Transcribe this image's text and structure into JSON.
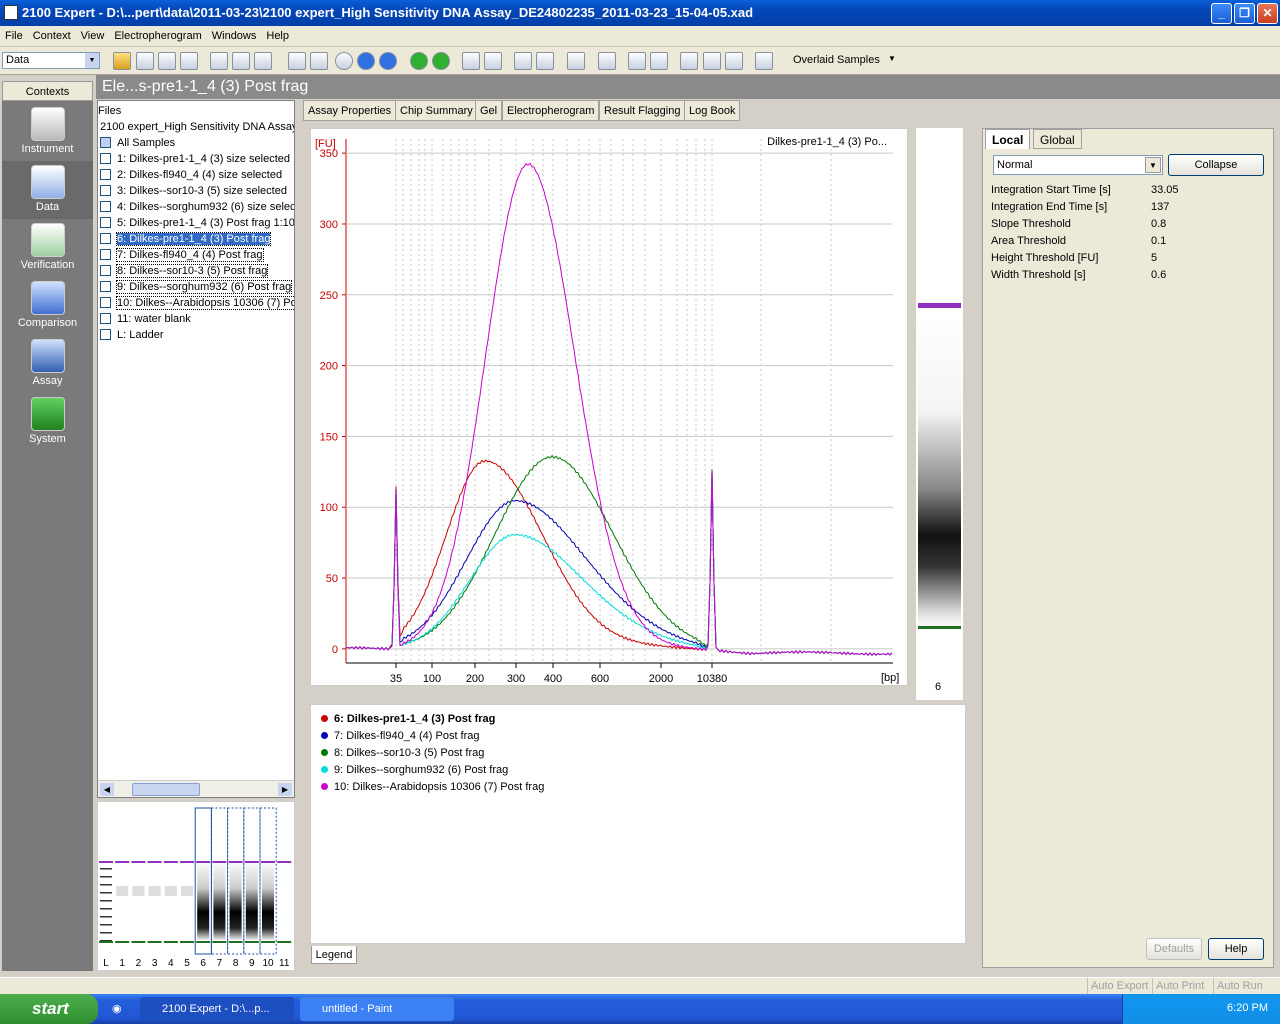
{
  "window": {
    "title": "2100 Expert - D:\\...pert\\data\\2011-03-23\\2100 expert_High Sensitivity DNA Assay_DE24802235_2011-03-23_15-04-05.xad"
  },
  "menu": [
    "File",
    "Context",
    "View",
    "Electropherogram",
    "Windows",
    "Help"
  ],
  "toolbar": {
    "context_value": "Data",
    "overlaid_label": "Overlaid Samples"
  },
  "contexts": {
    "header": "Contexts",
    "items": [
      "Instrument",
      "Data",
      "Verification",
      "Comparison",
      "Assay",
      "System"
    ]
  },
  "section_title": "Ele...s-pre1-1_4 (3) Post frag",
  "files": {
    "header": "Files",
    "assay": "2100 expert_High Sensitivity DNA Assay",
    "all": "All Samples",
    "samples": [
      "1: Dilkes-pre1-1_4 (3) size selected",
      "2: Dilkes-fl940_4 (4) size selected",
      "3: Dilkes--sor10-3 (5) size selected",
      "4: Dilkes--sorghum932 (6) size selected",
      "5: Dilkes-pre1-1_4 (3) Post frag 1:10",
      "6: Dilkes-pre1-1_4 (3) Post frag",
      "7: Dilkes-fl940_4 (4) Post frag",
      "8: Dilkes--sor10-3 (5) Post frag",
      "9: Dilkes--sorghum932 (6) Post frag",
      "10: Dilkes--Arabidopsis 10306 (7) Post frag",
      "11: water blank",
      "L: Ladder"
    ]
  },
  "gel_lanes": [
    "L",
    "1",
    "2",
    "3",
    "4",
    "5",
    "6",
    "7",
    "8",
    "9",
    "10",
    "11"
  ],
  "tabs": [
    "Assay Properties",
    "Chip Summary",
    "Gel",
    "Electropherogram",
    "Result Flagging",
    "Log Book"
  ],
  "chart_data": {
    "type": "line",
    "title": "Dilkes-pre1-1_4 (3) Po...",
    "ylabel": "[FU]",
    "xlabel": "[bp]",
    "ylim": [
      -10,
      360
    ],
    "yticks": [
      0,
      50,
      100,
      150,
      200,
      250,
      300,
      350
    ],
    "xticks": [
      "35",
      "100",
      "200",
      "300",
      "400",
      "600",
      "2000",
      "10380"
    ],
    "series": [
      {
        "name": "6: Dilkes-pre1-1_4 (3) Post frag",
        "color": "#cc0000",
        "peak_fu": 132,
        "peak_bp": 220
      },
      {
        "name": "7: Dilkes-fl940_4 (4) Post frag",
        "color": "#0000b0",
        "peak_fu": 104,
        "peak_bp": 300
      },
      {
        "name": "8: Dilkes--sor10-3 (5) Post frag",
        "color": "#007700",
        "peak_fu": 136,
        "peak_bp": 400
      },
      {
        "name": "9: Dilkes--sorghum932 (6) Post frag",
        "color": "#00dddd",
        "peak_fu": 80,
        "peak_bp": 300
      },
      {
        "name": "10: Dilkes--Arabidopsis 10306 (7) Post frag",
        "color": "#cc00cc",
        "peak_fu": 342,
        "peak_bp": 330
      }
    ]
  },
  "gel_strip_label": "6",
  "legend_tab": "Legend",
  "right": {
    "tabs": [
      "Local",
      "Global"
    ],
    "mode": "Normal",
    "collapse": "Collapse",
    "props": [
      {
        "k": "Integration Start Time [s]",
        "v": "33.05"
      },
      {
        "k": "Integration End Time [s]",
        "v": "137"
      },
      {
        "k": "Slope Threshold",
        "v": "0.8"
      },
      {
        "k": "Area Threshold",
        "v": "0.1"
      },
      {
        "k": "Height Threshold [FU]",
        "v": "5"
      },
      {
        "k": "Width Threshold [s]",
        "v": "0.6"
      }
    ],
    "defaults": "Defaults",
    "help": "Help"
  },
  "status": [
    "Auto Export",
    "Auto Print",
    "Auto Run"
  ],
  "taskbar": {
    "start": "start",
    "tasks": [
      "2100 Expert - D:\\...p...",
      "untitled - Paint"
    ],
    "clock": "6:20 PM"
  }
}
